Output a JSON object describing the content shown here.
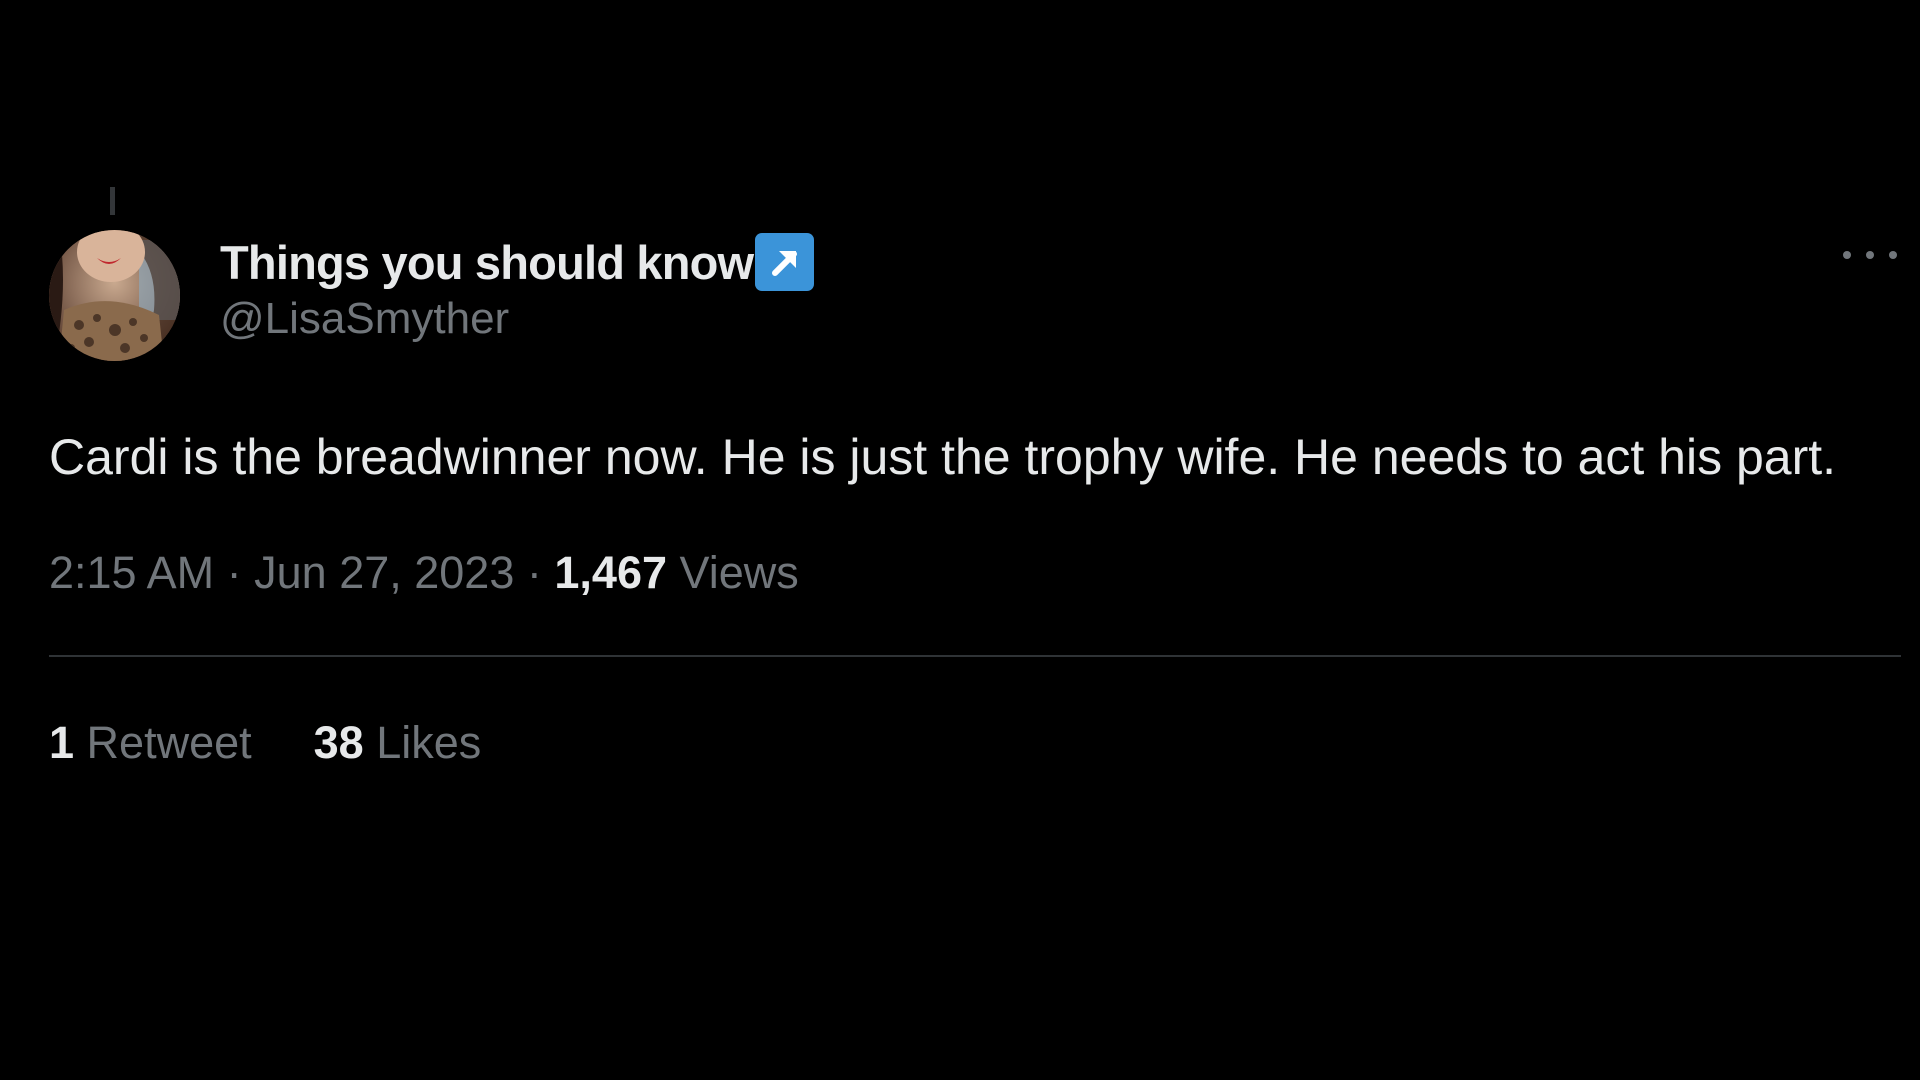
{
  "author": {
    "display_name": "Things you should know",
    "badge_icon": "north-east-arrow-icon",
    "handle": "@LisaSmyther"
  },
  "tweet": {
    "text": "Cardi is the breadwinner now. He is just the trophy wife. He needs to act his part.",
    "time": "2:15 AM",
    "separator": "·",
    "date": "Jun 27, 2023",
    "views_count": "1,467",
    "views_label": "Views"
  },
  "stats": {
    "retweets_count": "1",
    "retweets_label": "Retweet",
    "likes_count": "38",
    "likes_label": "Likes"
  },
  "colors": {
    "background": "#000000",
    "primary_text": "#e7e9ea",
    "secondary_text": "#71767b",
    "badge": "#3b94d9",
    "divider": "#2f3336"
  }
}
